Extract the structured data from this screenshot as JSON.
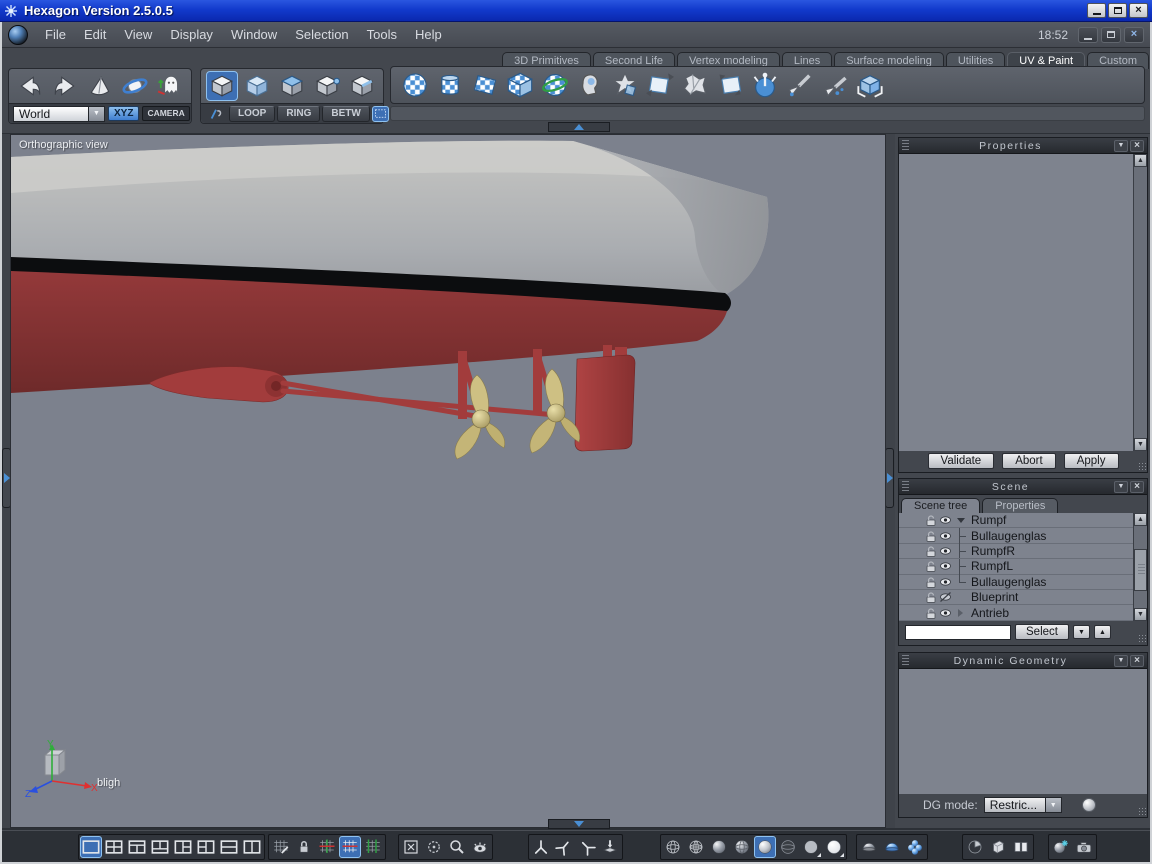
{
  "window": {
    "title": "Hexagon Version 2.5.0.5",
    "clock": "18:52"
  },
  "menu": {
    "items": [
      "File",
      "Edit",
      "View",
      "Display",
      "Window",
      "Selection",
      "Tools",
      "Help"
    ]
  },
  "tabs": {
    "items": [
      "3D Primitives",
      "Second Life",
      "Vertex modeling",
      "Lines",
      "Surface modeling",
      "Utilities",
      "UV & Paint",
      "Custom"
    ],
    "active": "UV & Paint"
  },
  "transform_bar": {
    "space_value": "World",
    "xyz": "XYZ",
    "camera": "CAMERA"
  },
  "selection_bar": {
    "loop": "LOOP",
    "ring": "RING",
    "betw": "BETW"
  },
  "viewport": {
    "view_label": "Orthographic view",
    "selected_object": "bligh",
    "axis_x": "X",
    "axis_y": "Y",
    "axis_z": "Z"
  },
  "properties_panel": {
    "title": "Properties",
    "validate": "Validate",
    "abort": "Abort",
    "apply": "Apply"
  },
  "scene_panel": {
    "title": "Scene",
    "tab_scene_tree": "Scene tree",
    "tab_properties": "Properties",
    "select_button": "Select",
    "search_value": "",
    "tree": [
      {
        "label": "Rumpf",
        "state": "expanded",
        "visible": true
      },
      {
        "label": "Bullaugenglas",
        "state": "child",
        "visible": true
      },
      {
        "label": "RumpfR",
        "state": "child",
        "visible": true
      },
      {
        "label": "RumpfL",
        "state": "child",
        "visible": true
      },
      {
        "label": "Bullaugenglas",
        "state": "child",
        "visible": true
      },
      {
        "label": "Blueprint",
        "state": "leaf",
        "visible": false
      },
      {
        "label": "Antrieb",
        "state": "collapsed",
        "visible": true
      }
    ]
  },
  "dynamic_geometry_panel": {
    "title": "Dynamic Geometry",
    "dg_mode_label": "DG mode:",
    "dg_mode_value": "Restric..."
  },
  "colors": {
    "titlebar_blue": "#1b46d8",
    "accent_blue": "#4a8fd4",
    "hull_gray": "#b4b4b2",
    "hull_red": "#8e3434",
    "waterline_black": "#0c0d0f",
    "propeller_bronze": "#c9b87c",
    "viewport_gray": "#7c818d"
  }
}
